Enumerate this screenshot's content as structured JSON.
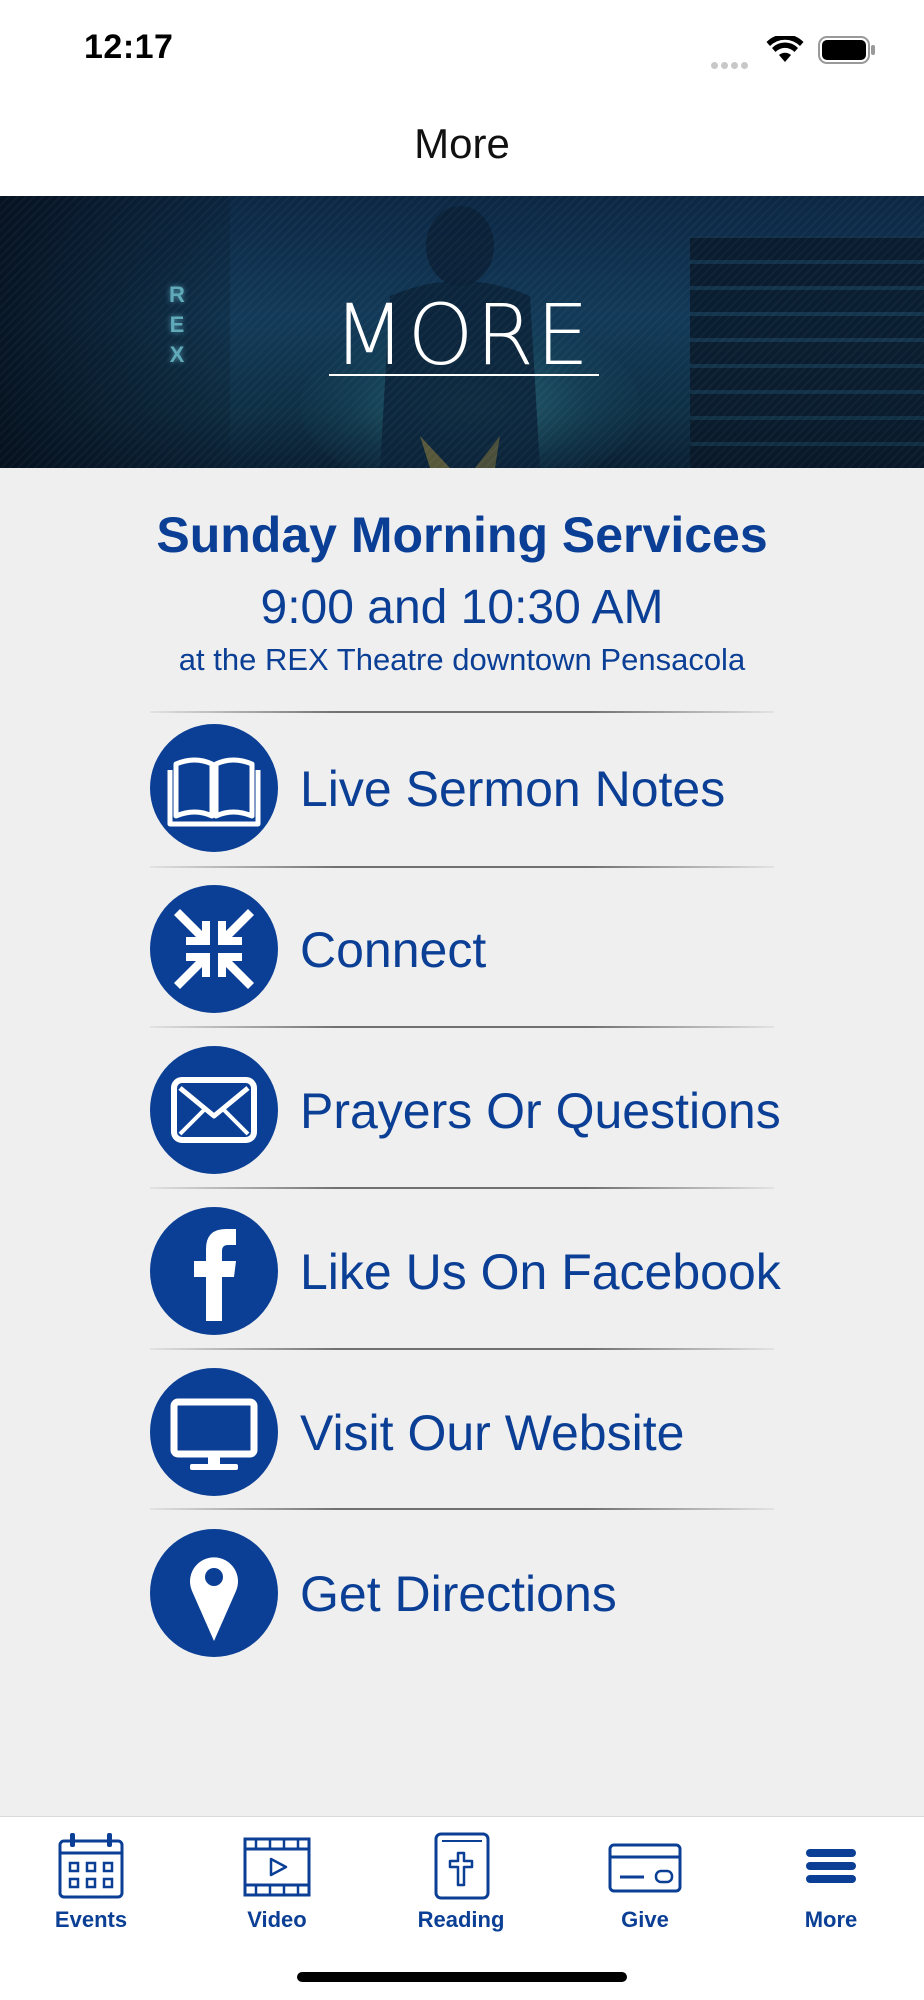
{
  "status_bar": {
    "time": "12:17"
  },
  "nav": {
    "title": "More"
  },
  "hero": {
    "title": "MORE",
    "sign_letters": [
      "R",
      "E",
      "X"
    ]
  },
  "services": {
    "title": "Sunday Morning Services",
    "time": "9:00 and 10:30 AM",
    "location": "at the REX Theatre downtown Pensacola"
  },
  "menu": {
    "items": [
      {
        "label": "Live Sermon Notes",
        "icon": "book-icon"
      },
      {
        "label": "Connect",
        "icon": "arrows-inward-icon"
      },
      {
        "label": "Prayers Or Questions",
        "icon": "envelope-icon"
      },
      {
        "label": "Like Us On Facebook",
        "icon": "facebook-icon"
      },
      {
        "label": "Visit Our Website",
        "icon": "monitor-icon"
      },
      {
        "label": "Get Directions",
        "icon": "map-pin-icon"
      }
    ]
  },
  "tab_bar": {
    "tabs": [
      {
        "label": "Events",
        "icon": "calendar-icon"
      },
      {
        "label": "Video",
        "icon": "video-icon"
      },
      {
        "label": "Reading",
        "icon": "bible-icon"
      },
      {
        "label": "Give",
        "icon": "credit-card-icon"
      },
      {
        "label": "More",
        "icon": "hamburger-icon"
      }
    ]
  },
  "colors": {
    "brand_blue": "#0b3f95",
    "background": "#efefef"
  }
}
